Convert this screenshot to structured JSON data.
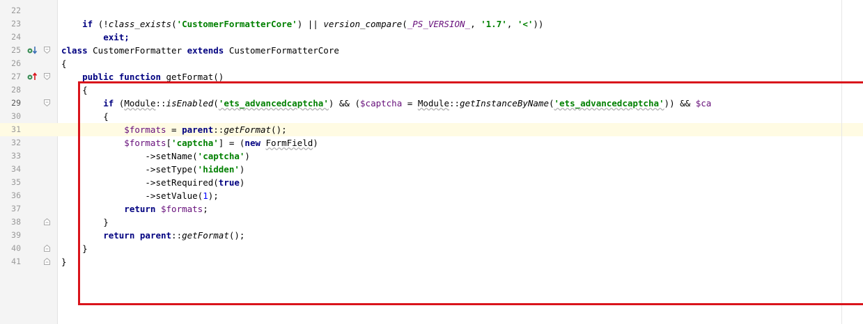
{
  "editor": {
    "current_line": "29",
    "lines": [
      {
        "num": "22",
        "tokens": []
      },
      {
        "num": "23",
        "tokens": [
          {
            "t": "    if ",
            "c": "kw"
          },
          {
            "t": "(!",
            "c": "pun"
          },
          {
            "t": "class_exists",
            "c": "it"
          },
          {
            "t": "(",
            "c": "pun"
          },
          {
            "t": "'CustomerFormatterCore'",
            "c": "str"
          },
          {
            "t": ") || ",
            "c": "pun"
          },
          {
            "t": "version_compare",
            "c": "it"
          },
          {
            "t": "(",
            "c": "pun"
          },
          {
            "t": "_PS_VERSION_",
            "c": "var it"
          },
          {
            "t": ", ",
            "c": "pun"
          },
          {
            "t": "'1.7'",
            "c": "str"
          },
          {
            "t": ", ",
            "c": "pun"
          },
          {
            "t": "'<'",
            "c": "str"
          },
          {
            "t": "))",
            "c": "pun"
          }
        ]
      },
      {
        "num": "24",
        "tokens": [
          {
            "t": "        exit;",
            "c": "kw"
          }
        ]
      },
      {
        "num": "25",
        "marker": "override-down",
        "fold": "start",
        "tokens": [
          {
            "t": "class ",
            "c": "kw"
          },
          {
            "t": "CustomerFormatter ",
            "c": "pun"
          },
          {
            "t": "extends ",
            "c": "kw"
          },
          {
            "t": "CustomerFormatterCore",
            "c": "pun"
          }
        ]
      },
      {
        "num": "26",
        "tokens": [
          {
            "t": "{",
            "c": "pun"
          }
        ]
      },
      {
        "num": "27",
        "marker": "override-up",
        "fold": "start",
        "tokens": [
          {
            "t": "    public function ",
            "c": "kw"
          },
          {
            "t": "getFormat()",
            "c": "pun"
          }
        ]
      },
      {
        "num": "28",
        "tokens": [
          {
            "t": "    {",
            "c": "pun"
          }
        ]
      },
      {
        "num": "29",
        "fold": "start",
        "highlight": true,
        "tokens": [
          {
            "t": "        if ",
            "c": "kw"
          },
          {
            "t": "(",
            "c": "pun"
          },
          {
            "t": "Module",
            "c": "pun squig"
          },
          {
            "t": "::",
            "c": "pun"
          },
          {
            "t": "isEnabled",
            "c": "it"
          },
          {
            "t": "(",
            "c": "pun"
          },
          {
            "t": "'ets_advancedcaptcha'",
            "c": "str squig"
          },
          {
            "t": ") && (",
            "c": "pun"
          },
          {
            "t": "$captcha",
            "c": "var"
          },
          {
            "t": " = ",
            "c": "pun"
          },
          {
            "t": "Module",
            "c": "pun squig"
          },
          {
            "t": "::",
            "c": "pun"
          },
          {
            "t": "getInstanceByName",
            "c": "it"
          },
          {
            "t": "(",
            "c": "pun"
          },
          {
            "t": "'ets_advancedcaptcha'",
            "c": "str squig"
          },
          {
            "t": ")) && ",
            "c": "pun"
          },
          {
            "t": "$ca",
            "c": "var"
          }
        ]
      },
      {
        "num": "30",
        "tokens": [
          {
            "t": "        {",
            "c": "pun"
          }
        ]
      },
      {
        "num": "31",
        "tokens": [
          {
            "t": "            $formats",
            "c": "var"
          },
          {
            "t": " = ",
            "c": "pun"
          },
          {
            "t": "parent",
            "c": "kw"
          },
          {
            "t": "::",
            "c": "pun"
          },
          {
            "t": "getFormat",
            "c": "it"
          },
          {
            "t": "();",
            "c": "pun"
          }
        ]
      },
      {
        "num": "32",
        "tokens": [
          {
            "t": "            $formats",
            "c": "var"
          },
          {
            "t": "[",
            "c": "pun"
          },
          {
            "t": "'captcha'",
            "c": "str"
          },
          {
            "t": "] = (",
            "c": "pun"
          },
          {
            "t": "new ",
            "c": "kw"
          },
          {
            "t": "FormField",
            "c": "pun squig"
          },
          {
            "t": ")",
            "c": "pun"
          }
        ]
      },
      {
        "num": "33",
        "tokens": [
          {
            "t": "                ->setName(",
            "c": "pun"
          },
          {
            "t": "'captcha'",
            "c": "str"
          },
          {
            "t": ")",
            "c": "pun"
          }
        ]
      },
      {
        "num": "34",
        "tokens": [
          {
            "t": "                ->setType(",
            "c": "pun"
          },
          {
            "t": "'hidden'",
            "c": "str"
          },
          {
            "t": ")",
            "c": "pun"
          }
        ]
      },
      {
        "num": "35",
        "tokens": [
          {
            "t": "                ->setRequired(",
            "c": "pun"
          },
          {
            "t": "true",
            "c": "kw"
          },
          {
            "t": ")",
            "c": "pun"
          }
        ]
      },
      {
        "num": "36",
        "tokens": [
          {
            "t": "                ->setValue(",
            "c": "pun"
          },
          {
            "t": "1",
            "c": "num"
          },
          {
            "t": ");",
            "c": "pun"
          }
        ]
      },
      {
        "num": "37",
        "tokens": [
          {
            "t": "            return ",
            "c": "kw"
          },
          {
            "t": "$formats",
            "c": "var"
          },
          {
            "t": ";",
            "c": "pun"
          }
        ]
      },
      {
        "num": "38",
        "fold": "end",
        "tokens": [
          {
            "t": "        }",
            "c": "pun"
          }
        ]
      },
      {
        "num": "39",
        "tokens": [
          {
            "t": "        return ",
            "c": "kw"
          },
          {
            "t": "parent",
            "c": "kw"
          },
          {
            "t": "::",
            "c": "pun"
          },
          {
            "t": "getFormat",
            "c": "it"
          },
          {
            "t": "();",
            "c": "pun"
          }
        ]
      },
      {
        "num": "40",
        "fold": "end",
        "tokens": [
          {
            "t": "    }",
            "c": "pun"
          }
        ]
      },
      {
        "num": "41",
        "fold": "end",
        "tokens": [
          {
            "t": "}",
            "c": "pun"
          }
        ]
      }
    ]
  },
  "colors": {
    "highlight_box": "#d9141b",
    "keyword": "#000080",
    "string": "#008000",
    "variable": "#660e7a",
    "override_icon": "#3d8f58"
  }
}
